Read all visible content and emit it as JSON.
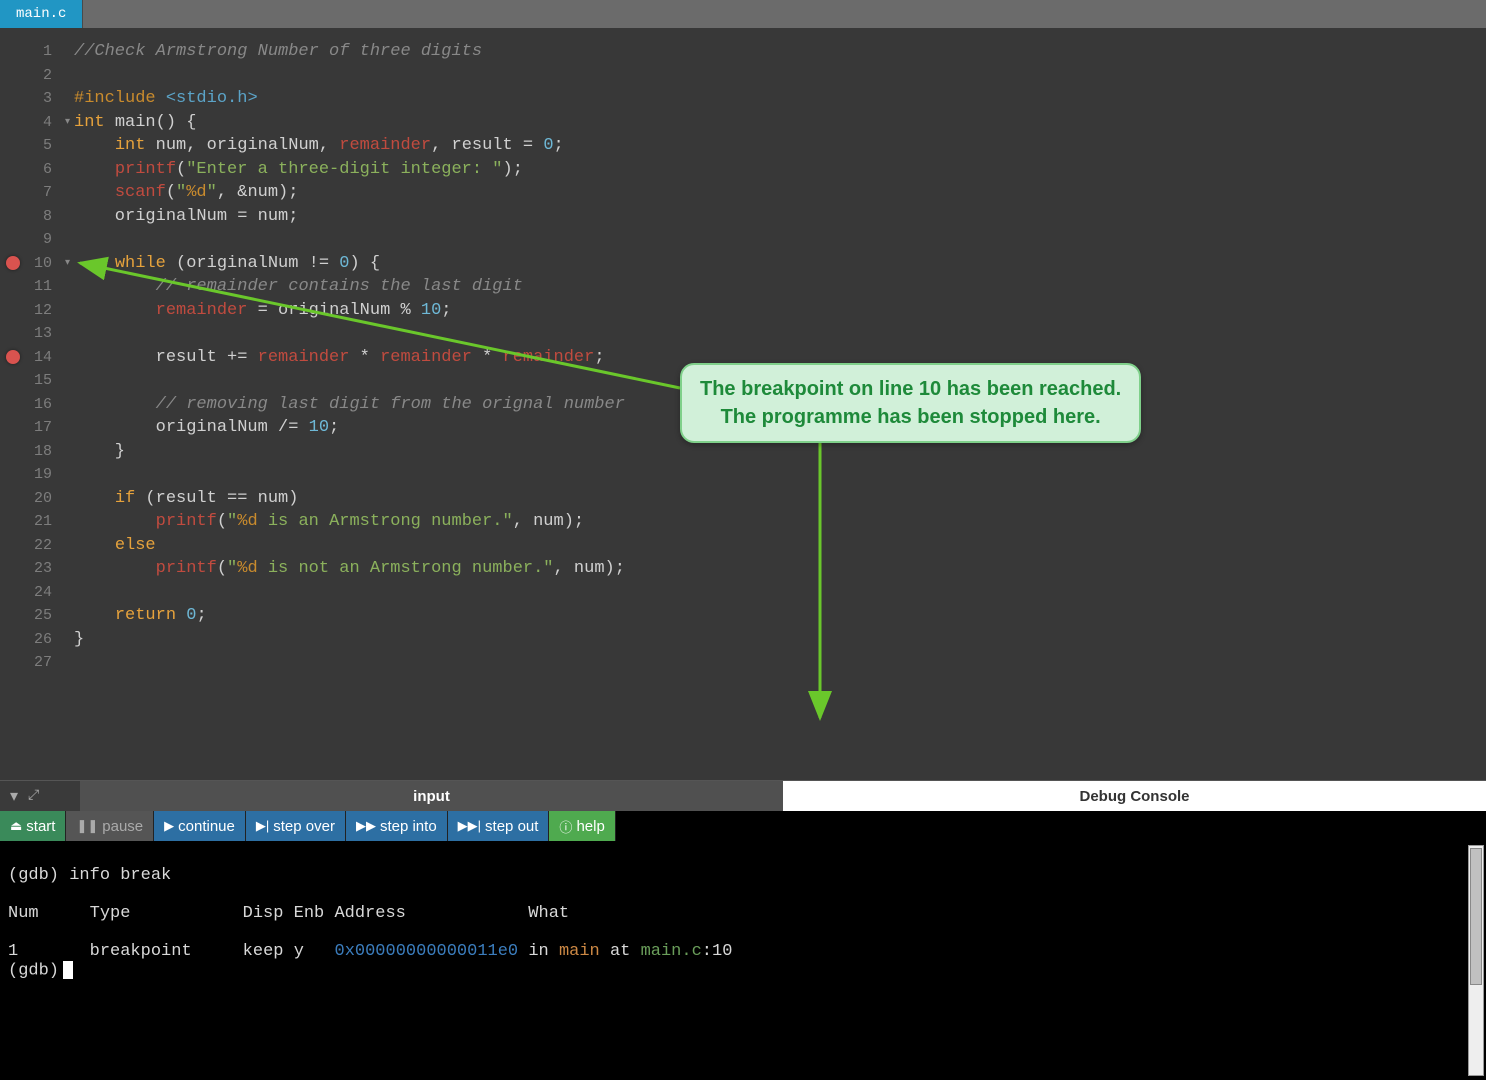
{
  "tab": {
    "label": "main.c"
  },
  "editor": {
    "breakpoint_lines": [
      10,
      14
    ],
    "fold_lines": [
      4,
      10
    ],
    "lines": [
      {
        "n": 1,
        "html": "<span class='c-comment'>//Check Armstrong Number of three digits</span>"
      },
      {
        "n": 2,
        "html": ""
      },
      {
        "n": 3,
        "html": "<span class='c-preproc'>#include</span> <span class='c-angle'>&lt;stdio.h&gt;</span>"
      },
      {
        "n": 4,
        "html": "<span class='c-type'>int</span> <span class='c-ident'>main</span>() {"
      },
      {
        "n": 5,
        "html": "    <span class='c-type'>int</span> num, originalNum, <span class='c-var2'>remainder</span>, result = <span class='c-num'>0</span>;"
      },
      {
        "n": 6,
        "html": "    <span class='c-func'>printf</span>(<span class='c-string'>\"Enter a three-digit integer: \"</span>);"
      },
      {
        "n": 7,
        "html": "    <span class='c-func'>scanf</span>(<span class='c-string'>\"</span><span class='c-fmt'>%d</span><span class='c-string'>\"</span>, &amp;num);"
      },
      {
        "n": 8,
        "html": "    originalNum = num;"
      },
      {
        "n": 9,
        "html": ""
      },
      {
        "n": 10,
        "html": "    <span class='kw2'>while</span> (originalNum != <span class='c-num'>0</span>) {"
      },
      {
        "n": 11,
        "html": "        <span class='c-comment'>// remainder contains the last digit</span>"
      },
      {
        "n": 12,
        "html": "        <span class='c-var2'>remainder</span> = originalNum % <span class='c-num'>10</span>;"
      },
      {
        "n": 13,
        "html": ""
      },
      {
        "n": 14,
        "html": "        result += <span class='c-var2'>remainder</span> * <span class='c-var2'>remainder</span> * <span class='c-var2'>remainder</span>;"
      },
      {
        "n": 15,
        "html": ""
      },
      {
        "n": 16,
        "html": "        <span class='c-comment'>// removing last digit from the orignal number</span>"
      },
      {
        "n": 17,
        "html": "        originalNum /= <span class='c-num'>10</span>;"
      },
      {
        "n": 18,
        "html": "    }"
      },
      {
        "n": 19,
        "html": ""
      },
      {
        "n": 20,
        "html": "    <span class='kw2'>if</span> (result == num)"
      },
      {
        "n": 21,
        "html": "        <span class='c-func'>printf</span>(<span class='c-string'>\"</span><span class='c-fmt'>%d</span><span class='c-string'> is an Armstrong number.\"</span>, num);"
      },
      {
        "n": 22,
        "html": "    <span class='kw2'>else</span>"
      },
      {
        "n": 23,
        "html": "        <span class='c-func'>printf</span>(<span class='c-string'>\"</span><span class='c-fmt'>%d</span><span class='c-string'> is not an Armstrong number.\"</span>, num);"
      },
      {
        "n": 24,
        "html": ""
      },
      {
        "n": 25,
        "html": "    <span class='kw2'>return</span> <span class='c-num'>0</span>;"
      },
      {
        "n": 26,
        "html": "}"
      },
      {
        "n": 27,
        "html": ""
      }
    ]
  },
  "annotation": {
    "line1": "The breakpoint on line 10 has been reached.",
    "line2": "The programme has been stopped here."
  },
  "pane_tabs": {
    "input": "input",
    "debug": "Debug Console"
  },
  "debug_buttons": {
    "start": "start",
    "pause": "pause",
    "continue": "continue",
    "step_over": "step over",
    "step_into": "step into",
    "step_out": "step out",
    "help": "help"
  },
  "console": {
    "prompt1": "(gdb) info break",
    "header": "Num     Type           Disp Enb Address            What",
    "row_num": "1",
    "row_type": "breakpoint",
    "row_disp": "keep",
    "row_enb": "y",
    "row_addr": "0x00000000000011e0",
    "row_in": "in",
    "row_func": "main",
    "row_at": "at",
    "row_file": "main.c",
    "row_line": ":10",
    "prompt2": "(gdb)"
  }
}
